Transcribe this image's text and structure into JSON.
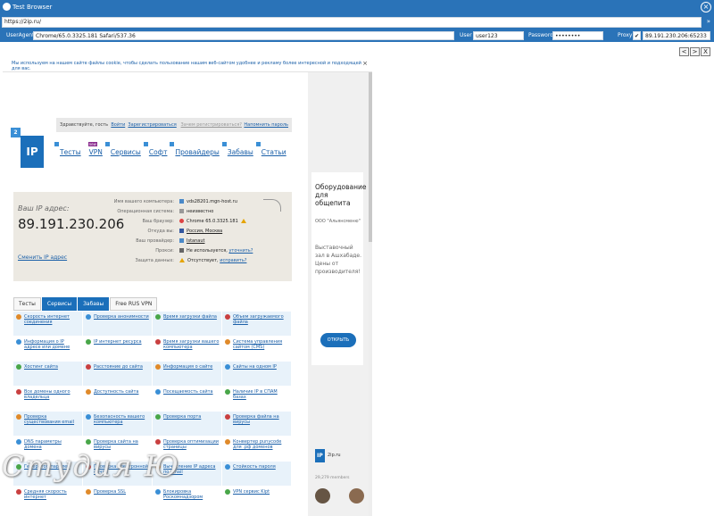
{
  "window": {
    "title": "Test Browser",
    "close": "×"
  },
  "urlbar": {
    "url": "https://2ip.ru/",
    "go": "»"
  },
  "settings": {
    "useragent_label": "UserAgent",
    "useragent_value": "Chrome/65.0.3325.181 Safari/537.36",
    "user_label": "User",
    "user_value": "user123",
    "password_label": "Password",
    "password_value": "••••••••",
    "proxy_label": "Proxy",
    "proxy_checked": "✔",
    "proxy_value": "89.191.230.206:65233"
  },
  "nav_buttons": [
    "<",
    ">",
    "X"
  ],
  "cookie": {
    "text": "Мы используем на нашем сайте файлы cookie, чтобы сделать пользование нашим веб-сайтом удобнее и рекламу более интересной и подходящей для вас.",
    "close": "×"
  },
  "greeting": {
    "hello": "Здравствуйте, гость",
    "login": "Войти",
    "register": "Зарегистрироваться",
    "why": "Зачем регистрироваться?",
    "restore": "Напомнить пароль"
  },
  "logo": {
    "small": "2",
    "big": "IP"
  },
  "menu": [
    {
      "label": "Тесты"
    },
    {
      "label": "VPN",
      "badge": "new"
    },
    {
      "label": "Сервисы"
    },
    {
      "label": "Софт"
    },
    {
      "label": "Провайдеры"
    },
    {
      "label": "Забавы"
    },
    {
      "label": "Статьи"
    }
  ],
  "ip": {
    "label": "Ваш IP адрес:",
    "value": "89.191.230.206",
    "change": "Сменить IP адрес"
  },
  "info": [
    {
      "k": "Имя вашего компьютера:",
      "v": "vds28201.mgn-host.ru"
    },
    {
      "k": "Операционная система:",
      "v": "неизвестно"
    },
    {
      "k": "Ваш браузер:",
      "v": "Chrome 65.0.3325.181"
    },
    {
      "k": "Откуда вы:",
      "v": "Россия, Москва"
    },
    {
      "k": "Ваш провайдер:",
      "v": "Istanaut"
    },
    {
      "k": "Прокси:",
      "v": "Не используется,",
      "v2": "уточнить?"
    },
    {
      "k": "Защита данных:",
      "v": "Отсутствует,",
      "v2": "исправить?"
    }
  ],
  "tabs": [
    "Тесты",
    "Сервисы",
    "Забавы",
    "Free RUS VPN"
  ],
  "services": [
    [
      "Скорость интернет соединения",
      "Проверка анонимности",
      "Время загрузки файла",
      "Объем загружаемого файла"
    ],
    [
      "Информация о IP адресе или домене",
      "IP интернет ресурса",
      "Время загрузки вашего компьютера",
      "Система управления сайтом (CMS)"
    ],
    [
      "Хостинг сайта",
      "Расстояние до сайта",
      "Информация о сайте",
      "Сайты на одном IP"
    ],
    [
      "Все домены одного владельца",
      "Доступность сайта",
      "Посещаемость сайта",
      "Наличие IP в СПАМ базах"
    ],
    [
      "Проверка существования email",
      "Безопасность вашего компьютера",
      "Проверка порта",
      "Проверка файла на вирусы"
    ],
    [
      "DNS параметры домена",
      "Проверка сайта на вирусы",
      "Проверка оптимизации страницы",
      "Конвертер punycode для .рф доменов"
    ],
    [
      "Генератор паролей",
      "Проверка электронной почты",
      "Вычисление IP адреса по email",
      "Стойкость пароля"
    ],
    [
      "Средняя скорость интернет",
      "Проверка SSL",
      "Блокировка Роскомнадзором",
      "VPN сервис Kipt"
    ]
  ],
  "ad": {
    "headline": "Оборудование для общепита",
    "company": "ООО \"Альянсменю\"",
    "desc": "Выставочный зал в Ашхабаде. Цены от производителя!",
    "button": "ОТКРЫТЬ"
  },
  "vk": {
    "logo": "IP",
    "name": "2ip.ru",
    "members": "29,279 members"
  },
  "watermark": "Студия Ю"
}
